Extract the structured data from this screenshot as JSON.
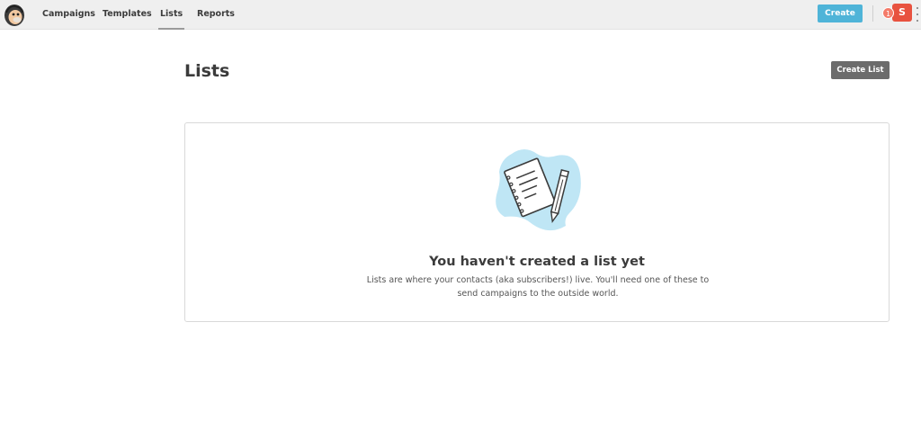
{
  "nav": {
    "items": [
      {
        "label": "Campaigns",
        "active": false
      },
      {
        "label": "Templates",
        "active": false
      },
      {
        "label": "Lists",
        "active": true
      },
      {
        "label": "Reports",
        "active": false
      }
    ]
  },
  "header": {
    "create_label": "Create",
    "notification_count": "1",
    "avatar_initial": "S"
  },
  "page": {
    "title": "Lists",
    "create_list_label": "Create List"
  },
  "empty_state": {
    "title": "You haven't created a list yet",
    "description": "Lists are where your contacts (aka subscribers!) live. You'll need one of these to send campaigns to the outside world."
  },
  "colors": {
    "create_button": "#4fb4d8",
    "create_list_button": "#6c6c6c",
    "avatar": "#e8523f",
    "notification": "#f47b6a",
    "illustration_blob": "#bfe6f5"
  },
  "icons": {
    "logo": "mailchimp-freddie-icon",
    "illustration": "notepad-pencil-icon",
    "more": "vertical-dots-icon"
  }
}
